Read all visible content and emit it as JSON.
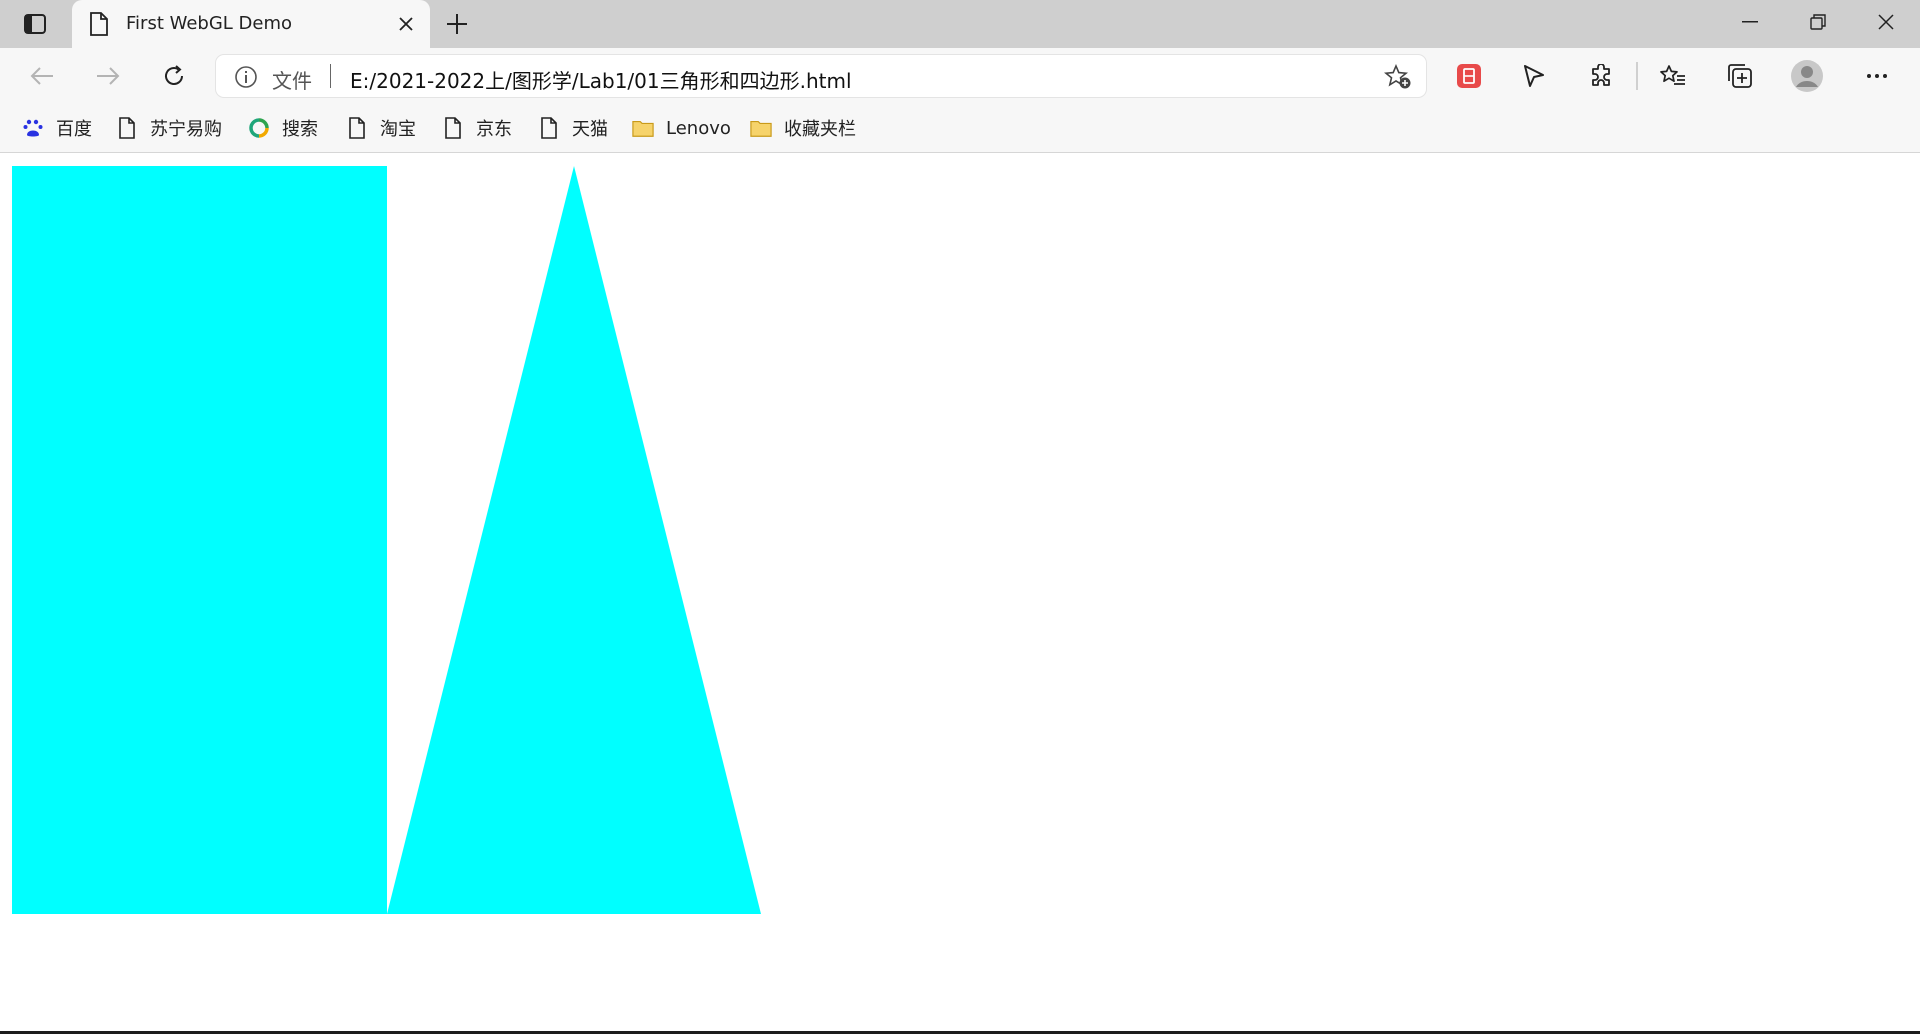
{
  "browser": {
    "tab": {
      "title": "First WebGL Demo"
    },
    "address": {
      "info_label": "文件",
      "url": "E:/2021-2022上/图形学/Lab1/01三角形和四边形.html"
    },
    "bookmarks": [
      {
        "label": "百度",
        "icon": "baidu-icon"
      },
      {
        "label": "苏宁易购",
        "icon": "page-icon"
      },
      {
        "label": "搜索",
        "icon": "search-ring-icon"
      },
      {
        "label": "淘宝",
        "icon": "page-icon"
      },
      {
        "label": "京东",
        "icon": "page-icon"
      },
      {
        "label": "天猫",
        "icon": "page-icon"
      },
      {
        "label": "Lenovo",
        "icon": "folder-icon"
      },
      {
        "label": "收藏夹栏",
        "icon": "folder-icon"
      }
    ],
    "colors": {
      "tabbar": "#cfcfcf",
      "toolbar": "#f7f7f7",
      "accent_red": "#e84a4a",
      "folder": "#f2c94c"
    }
  },
  "canvas": {
    "background": "#ffffff",
    "fill_color": "#00ffff",
    "shapes": [
      "quad",
      "triangle"
    ]
  }
}
